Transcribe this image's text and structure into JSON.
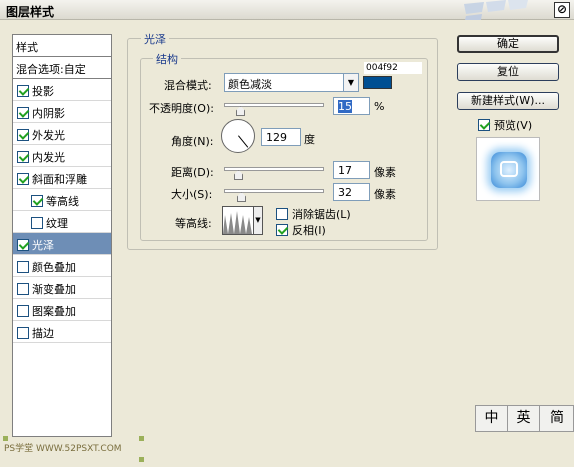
{
  "window": {
    "title": "图层样式",
    "close_label": "⊘"
  },
  "left_panel": {
    "header": "样式",
    "blend_options": "混合选项:自定",
    "items": [
      {
        "label": "投影",
        "checked": true,
        "sub": false,
        "selected": false
      },
      {
        "label": "内阴影",
        "checked": true,
        "sub": false,
        "selected": false
      },
      {
        "label": "外发光",
        "checked": true,
        "sub": false,
        "selected": false
      },
      {
        "label": "内发光",
        "checked": true,
        "sub": false,
        "selected": false
      },
      {
        "label": "斜面和浮雕",
        "checked": true,
        "sub": false,
        "selected": false
      },
      {
        "label": "等高线",
        "checked": true,
        "sub": true,
        "selected": false
      },
      {
        "label": "纹理",
        "checked": false,
        "sub": true,
        "selected": false
      },
      {
        "label": "光泽",
        "checked": true,
        "sub": false,
        "selected": true
      },
      {
        "label": "颜色叠加",
        "checked": false,
        "sub": false,
        "selected": false
      },
      {
        "label": "渐变叠加",
        "checked": false,
        "sub": false,
        "selected": false
      },
      {
        "label": "图案叠加",
        "checked": false,
        "sub": false,
        "selected": false
      },
      {
        "label": "描边",
        "checked": false,
        "sub": false,
        "selected": false
      }
    ]
  },
  "satin": {
    "group_title": "光泽",
    "structure_title": "结构",
    "blend_mode_label": "混合模式:",
    "blend_mode_value": "颜色减淡",
    "color_hex": "004f92",
    "color": "#004f92",
    "opacity_label": "不透明度(O):",
    "opacity_value": "15",
    "opacity_unit": "%",
    "angle_label": "角度(N):",
    "angle_value": "129",
    "angle_unit": "度",
    "distance_label": "距离(D):",
    "distance_value": "17",
    "distance_unit": "像素",
    "size_label": "大小(S):",
    "size_value": "32",
    "size_unit": "像素",
    "contour_label": "等高线:",
    "antialias_label": "消除锯齿(L)",
    "antialias_checked": false,
    "invert_label": "反相(I)",
    "invert_checked": true
  },
  "buttons": {
    "ok": "确定",
    "reset": "复位",
    "new_style": "新建样式(W)...",
    "preview_label": "预览(V)",
    "preview_checked": true
  },
  "ime": {
    "keys": [
      "中",
      "英",
      "简"
    ]
  },
  "watermark": "PS学堂 WWW.52PSXT.COM"
}
